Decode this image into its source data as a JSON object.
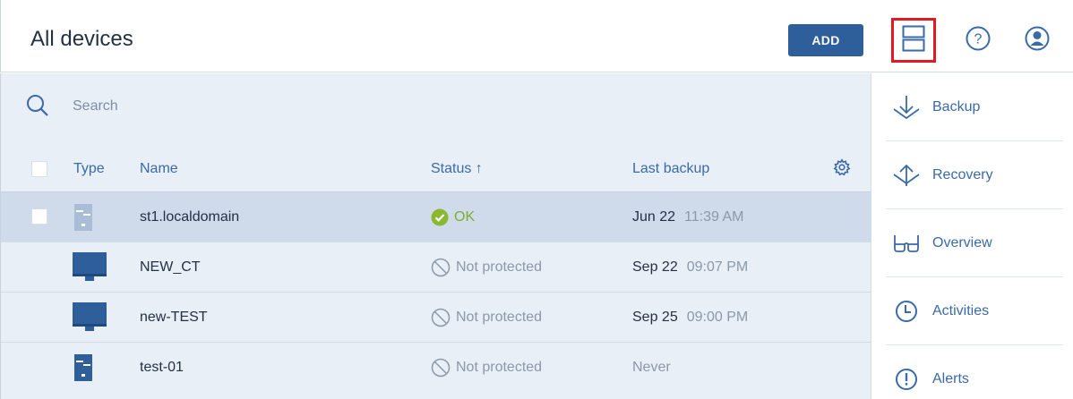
{
  "header": {
    "title": "All devices",
    "add_label": "ADD"
  },
  "search": {
    "placeholder": "Search"
  },
  "columns": {
    "type": "Type",
    "name": "Name",
    "status": "Status ↑",
    "last_backup": "Last backup"
  },
  "devices": [
    {
      "icon": "server-icon",
      "name": "st1.localdomain",
      "status": "OK",
      "status_kind": "ok",
      "date": "Jun 22",
      "time": "11:39 AM",
      "selected": true
    },
    {
      "icon": "monitor-icon",
      "name": "NEW_CT",
      "status": "Not protected",
      "status_kind": "not-protected",
      "date": "Sep 22",
      "time": "09:07 PM",
      "selected": false
    },
    {
      "icon": "monitor-icon",
      "name": "new-TEST",
      "status": "Not protected",
      "status_kind": "not-protected",
      "date": "Sep 25",
      "time": "09:00 PM",
      "selected": false
    },
    {
      "icon": "server-icon",
      "name": "test-01",
      "status": "Not protected",
      "status_kind": "not-protected",
      "date": "Never",
      "time": "",
      "selected": false
    }
  ],
  "sidebar": {
    "items": [
      {
        "label": "Backup",
        "icon": "backup-icon"
      },
      {
        "label": "Recovery",
        "icon": "recovery-icon"
      },
      {
        "label": "Overview",
        "icon": "glasses-icon"
      },
      {
        "label": "Activities",
        "icon": "clock-icon"
      },
      {
        "label": "Alerts",
        "icon": "alert-icon"
      }
    ]
  },
  "colors": {
    "accent": "#3a6aa7",
    "button": "#2f5f9b",
    "ok": "#7fae2e",
    "highlight": "#e11a22"
  }
}
